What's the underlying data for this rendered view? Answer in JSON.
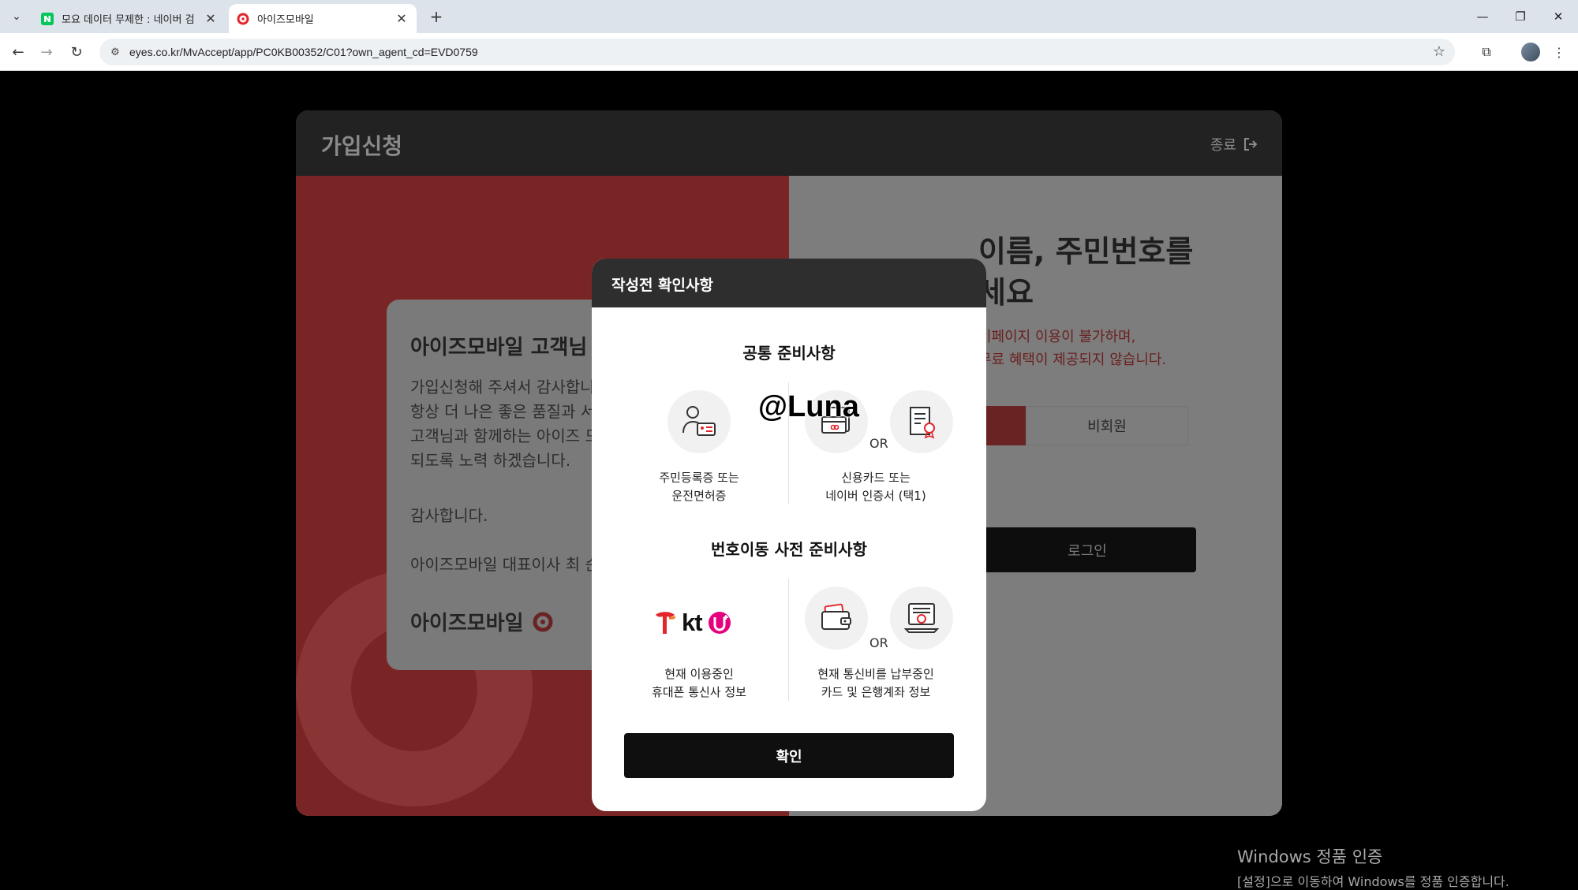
{
  "browser": {
    "tabs": [
      {
        "title": "모요 데이터 무제한 : 네이버 검"
      },
      {
        "title": "아이즈모바일"
      }
    ],
    "url": "eyes.co.kr/MvAccept/app/PC0KB00352/C01?own_agent_cd=EVD0759"
  },
  "app": {
    "title": "가입신청",
    "exit_label": "종료",
    "card": {
      "title": "아이즈모바일 고객님",
      "body": "가입신청해 주셔서 감사합니다\n항상 더 나은 좋은 품질과 서비\n고객님과 함께하는 아이즈 모\n되도록 노력 하겠습니다.",
      "thanks": "감사합니다.",
      "ceo": "아이즈모바일 대표이사 최 순",
      "logo": "아이즈모바일"
    },
    "right": {
      "heading": "이름, 주민번호를\n세요",
      "warning": "이페이지 이용이 불가하며,\n 무료 혜택이 제공되지 않습니다.",
      "guest_label": "비회원",
      "login_label": "로그인"
    }
  },
  "modal": {
    "title": "작성전 확인사항",
    "common_title": "공통 준비사항",
    "id_caption": "주민등록증 또는\n운전면허증",
    "cert_caption": "신용카드 또는\n네이버 인증서 (택1)",
    "or_label": "OR",
    "transfer_title": "번호이동 사전 준비사항",
    "carrier_caption": "현재 이용중인\n휴대폰 통신사 정보",
    "carrier_kt": "kt",
    "payment_caption": "현재 통신비를 납부중인\n카드 및 은행계좌 정보",
    "confirm_label": "확인"
  },
  "watermark": "@Luna",
  "windows_activation": {
    "line1": "Windows 정품 인증",
    "line2": "[설정]으로 이동하여 Windows를 정품 인증합니다."
  },
  "colors": {
    "brand_red": "#e3262c",
    "modal_header": "#2e2e2e",
    "button_dark": "#0f0f0f"
  }
}
